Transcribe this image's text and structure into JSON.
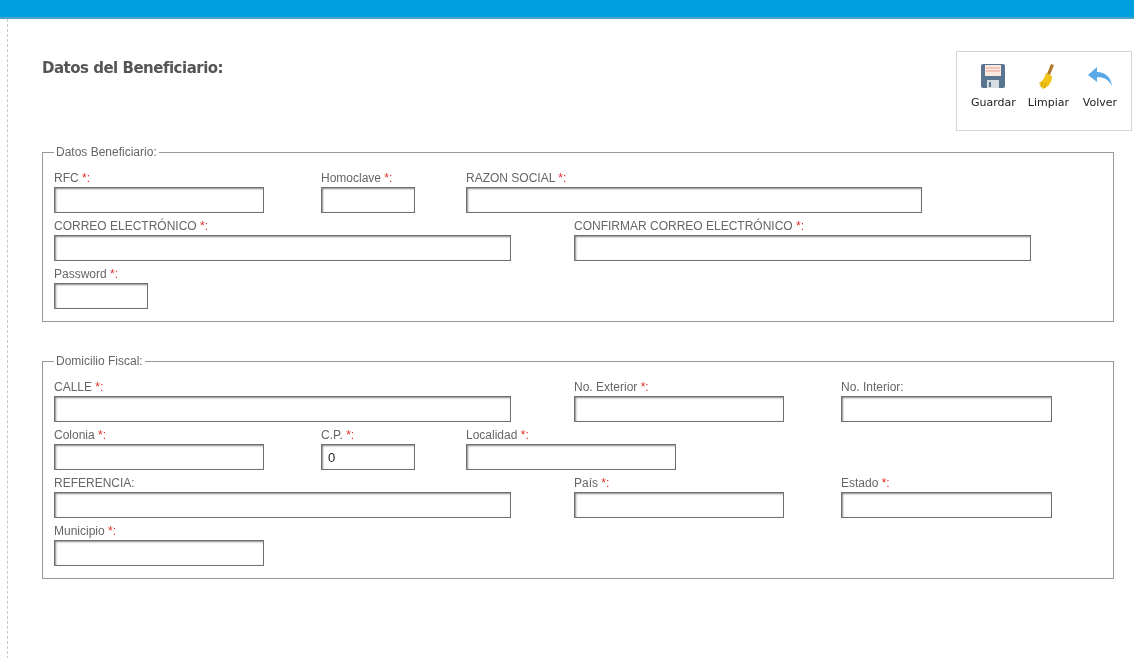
{
  "title": "Datos del Beneficiario:",
  "toolbar": [
    {
      "kind": "save",
      "label": "Guardar"
    },
    {
      "kind": "clear",
      "label": "Limpiar"
    },
    {
      "kind": "back",
      "label": "Volver"
    }
  ],
  "sections": [
    {
      "legend": "Datos Beneficiario:",
      "rows": [
        [
          {
            "label": "RFC ",
            "mark": "*:"
          },
          {
            "label": "Homoclave ",
            "mark": "*:"
          },
          {
            "label": "RAZON SOCIAL ",
            "mark": "*:"
          }
        ],
        [
          {
            "label": "CORREO ELECTRÓNICO ",
            "mark": "*:"
          },
          {
            "label": "CONFIRMAR CORREO ELECTRÓNICO ",
            "mark": "*:"
          }
        ],
        [
          {
            "label": "Password ",
            "mark": "*:"
          }
        ]
      ]
    },
    {
      "legend": "Domicilio Fiscal:",
      "rows": [
        [
          {
            "label": "CALLE ",
            "mark": "*:"
          },
          {
            "label": "No. Exterior ",
            "mark": "*:"
          },
          {
            "label": "No. Interior:"
          }
        ],
        [
          {
            "label": "Colonia ",
            "mark": "*:"
          },
          {
            "label": "C.P. ",
            "mark": "*:",
            "value": "0"
          },
          {
            "label": "Localidad ",
            "mark": "*:"
          }
        ],
        [
          {
            "label": "REFERENCIA:"
          },
          {
            "label": "País ",
            "mark": "*:"
          },
          {
            "label": "Estado ",
            "mark": "*:"
          }
        ],
        [
          {
            "label": "Municipio ",
            "mark": "*:"
          }
        ]
      ]
    }
  ]
}
